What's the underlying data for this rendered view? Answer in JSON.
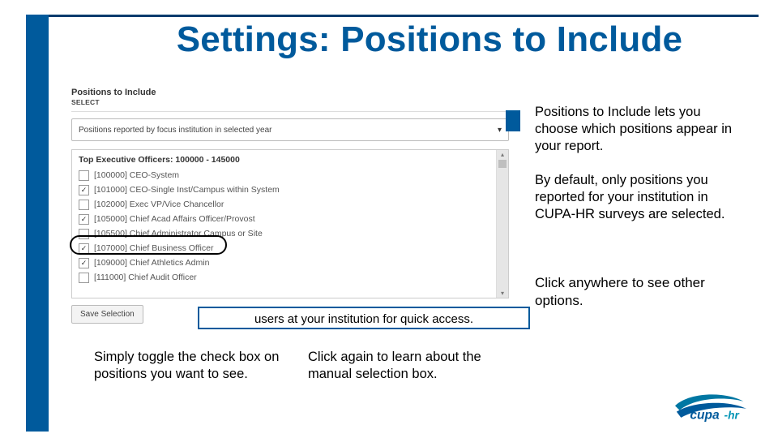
{
  "title": "Settings: Positions to Include",
  "panel": {
    "header": "Positions to Include",
    "select_label": "SELECT",
    "dropdown_value": "Positions reported by focus institution in selected year",
    "group_header": "Top Executive Officers: 100000 - 145000",
    "save_button": "Save Selection",
    "items": [
      {
        "code": "[100000]",
        "label": "CEO-System",
        "checked": false
      },
      {
        "code": "[101000]",
        "label": "CEO-Single Inst/Campus within System",
        "checked": true
      },
      {
        "code": "[102000]",
        "label": "Exec VP/Vice Chancellor",
        "checked": false
      },
      {
        "code": "[105000]",
        "label": "Chief Acad Affairs Officer/Provost",
        "checked": true
      },
      {
        "code": "[105500]",
        "label": "Chief Administrator Campus or Site",
        "checked": false
      },
      {
        "code": "[107000]",
        "label": "Chief Business Officer",
        "checked": true,
        "highlight": true
      },
      {
        "code": "[109000]",
        "label": "Chief Athletics Admin",
        "checked": true
      },
      {
        "code": "[111000]",
        "label": "Chief Audit Officer",
        "checked": false
      }
    ]
  },
  "right": {
    "p1": "Positions to Include lets you choose which positions appear in your report.",
    "p2": "By default, only positions you reported for your institution in CUPA-HR surveys are selected.",
    "p3": "Click anywhere to see other options."
  },
  "notebox_visible_line": "users at your institution for quick access.",
  "caps": {
    "left": "Simply toggle the check box on positions you want to see.",
    "right": "Click again to learn about the manual selection box."
  },
  "logo_text": "cupa-hr"
}
